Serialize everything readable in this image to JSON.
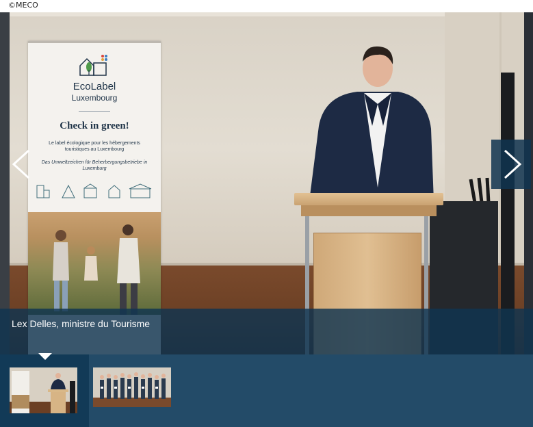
{
  "credit": "©MECO",
  "banner": {
    "logo_line1": "EcoLabel",
    "logo_line2": "Luxembourg",
    "headline": "Check in green!",
    "text_fr": "Le label écologique pour les hébergements touristiques au Luxembourg",
    "text_de": "Das Umweltzeichen für Beherbergungsbetriebe in Luxemburg"
  },
  "caption": "Lex Delles, ministre du Tourisme",
  "navigation": {
    "prev_icon": "chevron-left-icon",
    "next_icon": "chevron-right-icon"
  },
  "thumbnails": [
    {
      "name": "speaker-photo",
      "active": true
    },
    {
      "name": "group-photo",
      "active": false
    }
  ],
  "colors": {
    "caption_bg": "#103450",
    "strip_bg": "#234b68",
    "active_thumb_bg": "#123a57"
  }
}
